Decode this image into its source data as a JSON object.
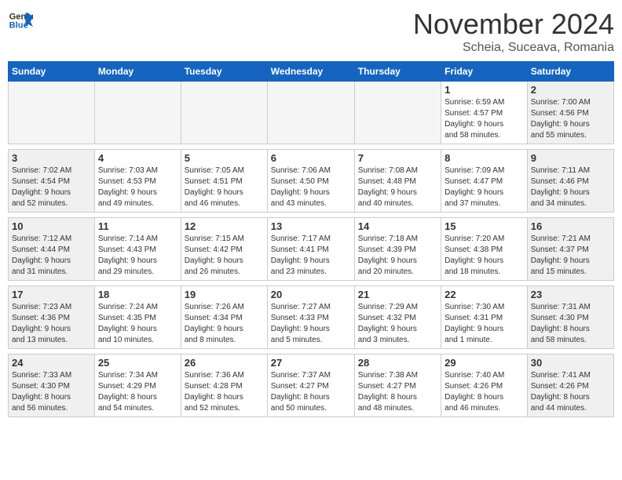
{
  "header": {
    "logo_general": "General",
    "logo_blue": "Blue",
    "month": "November 2024",
    "location": "Scheia, Suceava, Romania"
  },
  "days_of_week": [
    "Sunday",
    "Monday",
    "Tuesday",
    "Wednesday",
    "Thursday",
    "Friday",
    "Saturday"
  ],
  "weeks": [
    [
      {
        "day": "",
        "info": ""
      },
      {
        "day": "",
        "info": ""
      },
      {
        "day": "",
        "info": ""
      },
      {
        "day": "",
        "info": ""
      },
      {
        "day": "",
        "info": ""
      },
      {
        "day": "1",
        "info": "Sunrise: 6:59 AM\nSunset: 4:57 PM\nDaylight: 9 hours\nand 58 minutes."
      },
      {
        "day": "2",
        "info": "Sunrise: 7:00 AM\nSunset: 4:56 PM\nDaylight: 9 hours\nand 55 minutes."
      }
    ],
    [
      {
        "day": "3",
        "info": "Sunrise: 7:02 AM\nSunset: 4:54 PM\nDaylight: 9 hours\nand 52 minutes."
      },
      {
        "day": "4",
        "info": "Sunrise: 7:03 AM\nSunset: 4:53 PM\nDaylight: 9 hours\nand 49 minutes."
      },
      {
        "day": "5",
        "info": "Sunrise: 7:05 AM\nSunset: 4:51 PM\nDaylight: 9 hours\nand 46 minutes."
      },
      {
        "day": "6",
        "info": "Sunrise: 7:06 AM\nSunset: 4:50 PM\nDaylight: 9 hours\nand 43 minutes."
      },
      {
        "day": "7",
        "info": "Sunrise: 7:08 AM\nSunset: 4:48 PM\nDaylight: 9 hours\nand 40 minutes."
      },
      {
        "day": "8",
        "info": "Sunrise: 7:09 AM\nSunset: 4:47 PM\nDaylight: 9 hours\nand 37 minutes."
      },
      {
        "day": "9",
        "info": "Sunrise: 7:11 AM\nSunset: 4:46 PM\nDaylight: 9 hours\nand 34 minutes."
      }
    ],
    [
      {
        "day": "10",
        "info": "Sunrise: 7:12 AM\nSunset: 4:44 PM\nDaylight: 9 hours\nand 31 minutes."
      },
      {
        "day": "11",
        "info": "Sunrise: 7:14 AM\nSunset: 4:43 PM\nDaylight: 9 hours\nand 29 minutes."
      },
      {
        "day": "12",
        "info": "Sunrise: 7:15 AM\nSunset: 4:42 PM\nDaylight: 9 hours\nand 26 minutes."
      },
      {
        "day": "13",
        "info": "Sunrise: 7:17 AM\nSunset: 4:41 PM\nDaylight: 9 hours\nand 23 minutes."
      },
      {
        "day": "14",
        "info": "Sunrise: 7:18 AM\nSunset: 4:39 PM\nDaylight: 9 hours\nand 20 minutes."
      },
      {
        "day": "15",
        "info": "Sunrise: 7:20 AM\nSunset: 4:38 PM\nDaylight: 9 hours\nand 18 minutes."
      },
      {
        "day": "16",
        "info": "Sunrise: 7:21 AM\nSunset: 4:37 PM\nDaylight: 9 hours\nand 15 minutes."
      }
    ],
    [
      {
        "day": "17",
        "info": "Sunrise: 7:23 AM\nSunset: 4:36 PM\nDaylight: 9 hours\nand 13 minutes."
      },
      {
        "day": "18",
        "info": "Sunrise: 7:24 AM\nSunset: 4:35 PM\nDaylight: 9 hours\nand 10 minutes."
      },
      {
        "day": "19",
        "info": "Sunrise: 7:26 AM\nSunset: 4:34 PM\nDaylight: 9 hours\nand 8 minutes."
      },
      {
        "day": "20",
        "info": "Sunrise: 7:27 AM\nSunset: 4:33 PM\nDaylight: 9 hours\nand 5 minutes."
      },
      {
        "day": "21",
        "info": "Sunrise: 7:29 AM\nSunset: 4:32 PM\nDaylight: 9 hours\nand 3 minutes."
      },
      {
        "day": "22",
        "info": "Sunrise: 7:30 AM\nSunset: 4:31 PM\nDaylight: 9 hours\nand 1 minute."
      },
      {
        "day": "23",
        "info": "Sunrise: 7:31 AM\nSunset: 4:30 PM\nDaylight: 8 hours\nand 58 minutes."
      }
    ],
    [
      {
        "day": "24",
        "info": "Sunrise: 7:33 AM\nSunset: 4:30 PM\nDaylight: 8 hours\nand 56 minutes."
      },
      {
        "day": "25",
        "info": "Sunrise: 7:34 AM\nSunset: 4:29 PM\nDaylight: 8 hours\nand 54 minutes."
      },
      {
        "day": "26",
        "info": "Sunrise: 7:36 AM\nSunset: 4:28 PM\nDaylight: 8 hours\nand 52 minutes."
      },
      {
        "day": "27",
        "info": "Sunrise: 7:37 AM\nSunset: 4:27 PM\nDaylight: 8 hours\nand 50 minutes."
      },
      {
        "day": "28",
        "info": "Sunrise: 7:38 AM\nSunset: 4:27 PM\nDaylight: 8 hours\nand 48 minutes."
      },
      {
        "day": "29",
        "info": "Sunrise: 7:40 AM\nSunset: 4:26 PM\nDaylight: 8 hours\nand 46 minutes."
      },
      {
        "day": "30",
        "info": "Sunrise: 7:41 AM\nSunset: 4:26 PM\nDaylight: 8 hours\nand 44 minutes."
      }
    ]
  ]
}
